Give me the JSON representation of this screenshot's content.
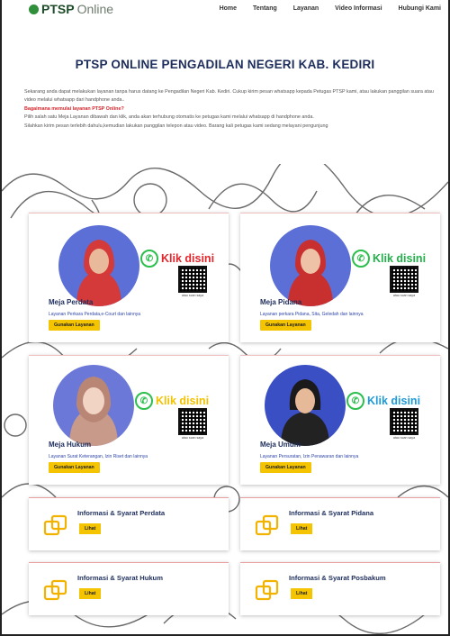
{
  "brand": {
    "strong": "PTSP",
    "light": "Online"
  },
  "nav": [
    "Home",
    "Tentang",
    "Layanan",
    "Video Informasi",
    "Hubungi Kami"
  ],
  "title": "PTSP ONLINE PENGADILAN NEGERI KAB. KEDIRI",
  "intro": {
    "p1": "Sekarang anda dapat melakukan layanan tanpa harus datang ke Pengadilan Negeri Kab. Kediri. Cukup kirim pesan whatsapp kepada Petugas PTSP kami, atau lakukan panggilan suara atau video melalui whatsapp dari handphone anda..",
    "question": "Bagaimana memulai layanan PTSP Online?",
    "p2": "Pilih salah satu Meja Layanan dibawah dan klik, anda akan terhubung otomatis ke petugas kami melalui whatsapp di handphone anda.",
    "p3": "Silahkan kirim pesan terlebih dahulu,kemudian lakukan panggilan telepon atau video. Barang kali petugas kami sedang melayani pengunjung"
  },
  "desks": [
    {
      "name": "Meja Perdata",
      "desc": "Layanan Perkara Perdata,e-Court dan lainnya",
      "cta": "Klik disini",
      "cta_color": "#e2262c",
      "qr_caption": "atau scan saya",
      "button": "Gunakan Layanan"
    },
    {
      "name": "Meja Pidana",
      "desc": "Layanan perkara Pidana, Sita, Geledah dan lainnya",
      "cta": "Klik disini",
      "cta_color": "#23b04a",
      "qr_caption": "atau scan saya",
      "button": "Gunakan Layanan"
    },
    {
      "name": "Meja Hukum",
      "desc": "Layanan Surat Keterangan, Izin Riset dan lainnya",
      "cta": "Klik disini",
      "cta_color": "#f2c200",
      "qr_caption": "atau scan saya",
      "button": "Gunakan Layanan"
    },
    {
      "name": "Meja Umum",
      "desc": "Layanan Persuratan, Izin Penawaran dan lainnya",
      "cta": "Klik disini",
      "cta_color": "#1f9ad6",
      "qr_caption": "atau scan saya",
      "button": "Gunakan Layanan"
    }
  ],
  "info_cards": [
    {
      "title": "Informasi & Syarat Perdata",
      "button": "Lihat"
    },
    {
      "title": "Informasi & Syarat Pidana",
      "button": "Lihat"
    },
    {
      "title": "Informasi & Syarat Hukum",
      "button": "Lihat"
    },
    {
      "title": "Informasi & Syarat Posbakum",
      "button": "Lihat"
    }
  ],
  "colors": {
    "accent": "#f5c400",
    "navy": "#1d2d5c",
    "brand_green": "#2f8f3a",
    "link_blue": "#2e46a8",
    "red": "#d6262c"
  }
}
